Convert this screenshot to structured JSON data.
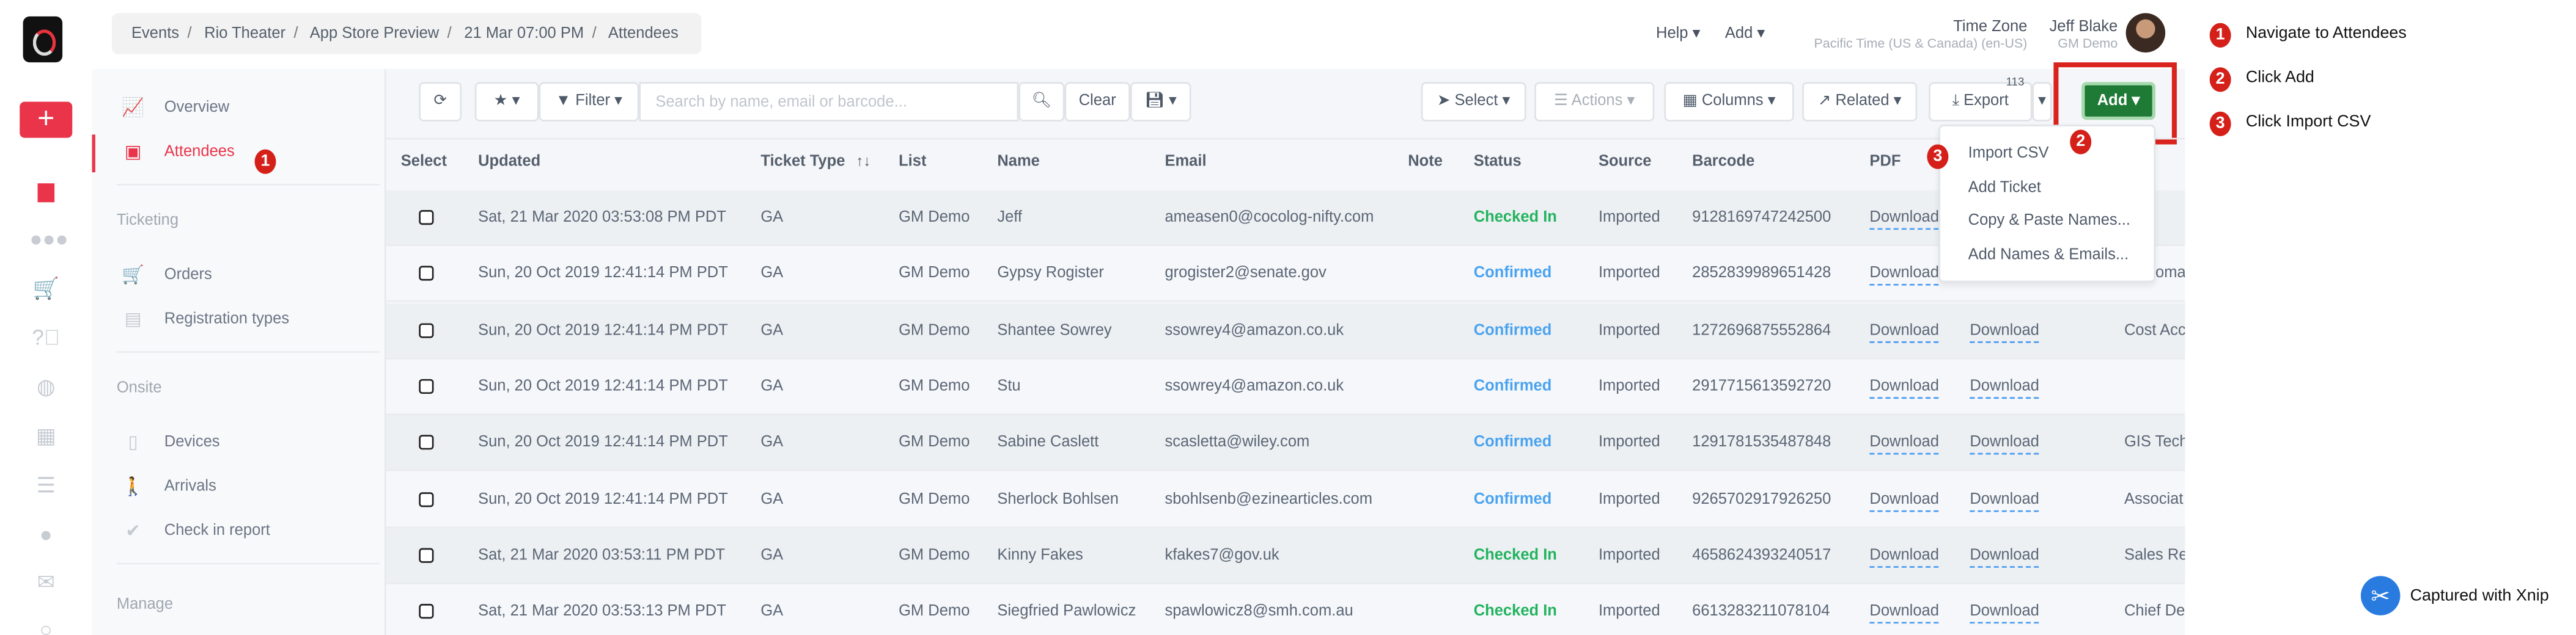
{
  "breadcrumb": [
    "Events",
    "Rio Theater",
    "App Store Preview",
    "21 Mar 07:00 PM",
    "Attendees"
  ],
  "header": {
    "help": "Help",
    "add": "Add",
    "timezone_label": "Time Zone",
    "timezone_value": "Pacific Time (US & Canada) (en-US)",
    "user_name": "Jeff Blake",
    "user_org": "GM Demo"
  },
  "rail_icons": [
    "calendar-icon",
    "users-icon",
    "cart-icon",
    "question-icon",
    "globe-icon",
    "gift-icon",
    "numbered-list-icon",
    "user-icon",
    "mail-icon",
    "circle-icon"
  ],
  "sidebar": {
    "overview": "Overview",
    "attendees": "Attendees",
    "ticketing": "Ticketing",
    "orders": "Orders",
    "registration_types": "Registration types",
    "onsite": "Onsite",
    "devices": "Devices",
    "arrivals": "Arrivals",
    "check_in_report": "Check in report",
    "manage": "Manage"
  },
  "toolbar": {
    "filter": "Filter",
    "search_placeholder": "Search by name, email or barcode...",
    "clear": "Clear",
    "select": "Select",
    "actions": "Actions",
    "columns": "Columns",
    "related": "Related",
    "export": "Export",
    "export_count": "113",
    "add": "Add"
  },
  "add_menu": [
    "Import CSV",
    "Add Ticket",
    "Copy & Paste Names...",
    "Add Names & Emails..."
  ],
  "table": {
    "headers": [
      "Select",
      "Updated",
      "Ticket Type",
      "List",
      "Name",
      "Email",
      "Note",
      "Status",
      "Source",
      "Barcode",
      "PDF"
    ],
    "rows": [
      {
        "updated": "Sat, 21 Mar 2020 03:53:08 PM PDT",
        "type": "GA",
        "list": "GM Demo",
        "name": "Jeff",
        "email": "ameasen0@cocolog-nifty.com",
        "status": "Checked In",
        "source": "Imported",
        "barcode": "9128169747242500",
        "pdf": "Download",
        "dl2": "",
        "last": ""
      },
      {
        "updated": "Sun, 20 Oct 2019 12:41:14 PM PDT",
        "type": "GA",
        "list": "GM Demo",
        "name": "Gypsy Rogister",
        "email": "grogister2@senate.gov",
        "status": "Confirmed",
        "source": "Imported",
        "barcode": "2852839989651428",
        "pdf": "Download",
        "dl2": "",
        "last": "omat"
      },
      {
        "updated": "Sun, 20 Oct 2019 12:41:14 PM PDT",
        "type": "GA",
        "list": "GM Demo",
        "name": "Shantee Sowrey",
        "email": "ssowrey4@amazon.co.uk",
        "status": "Confirmed",
        "source": "Imported",
        "barcode": "1272696875552864",
        "pdf": "Download",
        "dl2": "Download",
        "last": "Cost Acc"
      },
      {
        "updated": "Sun, 20 Oct 2019 12:41:14 PM PDT",
        "type": "GA",
        "list": "GM Demo",
        "name": "Stu",
        "email": "ssowrey4@amazon.co.uk",
        "status": "Confirmed",
        "source": "Imported",
        "barcode": "2917715613592720",
        "pdf": "Download",
        "dl2": "Download",
        "last": ""
      },
      {
        "updated": "Sun, 20 Oct 2019 12:41:14 PM PDT",
        "type": "GA",
        "list": "GM Demo",
        "name": "Sabine Caslett",
        "email": "scasletta@wiley.com",
        "status": "Confirmed",
        "source": "Imported",
        "barcode": "1291781535487848",
        "pdf": "Download",
        "dl2": "Download",
        "last": "GIS Tech"
      },
      {
        "updated": "Sun, 20 Oct 2019 12:41:14 PM PDT",
        "type": "GA",
        "list": "GM Demo",
        "name": "Sherlock Bohlsen",
        "email": "sbohlsenb@ezinearticles.com",
        "status": "Confirmed",
        "source": "Imported",
        "barcode": "9265702917926250",
        "pdf": "Download",
        "dl2": "Download",
        "last": "Associat"
      },
      {
        "updated": "Sat, 21 Mar 2020 03:53:11 PM PDT",
        "type": "GA",
        "list": "GM Demo",
        "name": "Kinny Fakes",
        "email": "kfakes7@gov.uk",
        "status": "Checked In",
        "source": "Imported",
        "barcode": "4658624393240517",
        "pdf": "Download",
        "dl2": "Download",
        "last": "Sales Re"
      },
      {
        "updated": "Sat, 21 Mar 2020 03:53:13 PM PDT",
        "type": "GA",
        "list": "GM Demo",
        "name": "Siegfried Pawlowicz",
        "email": "spawlowicz8@smh.com.au",
        "status": "Checked In",
        "source": "Imported",
        "barcode": "6613283211078104",
        "pdf": "Download",
        "dl2": "Download",
        "last": "Chief De"
      }
    ]
  },
  "annotations": [
    {
      "n": "1",
      "text": "Navigate to Attendees"
    },
    {
      "n": "2",
      "text": "Click Add"
    },
    {
      "n": "3",
      "text": "Click Import CSV"
    }
  ],
  "watermark": "Captured with Xnip",
  "colors": {
    "accent": "#e9344a",
    "add_button": "#1f7a36",
    "checked_in": "#22b35e",
    "confirmed": "#4aa3f0",
    "annotation": "#d5201a"
  }
}
